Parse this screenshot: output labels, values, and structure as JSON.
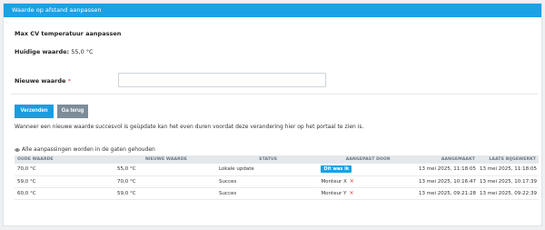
{
  "header": {
    "title": "Waarde op afstand aanpassen"
  },
  "form": {
    "title": "Max CV temperatuur aanpassen",
    "current_label": "Huidige waarde:",
    "current_value": "55,0 °C",
    "new_label": "Nieuwe waarde",
    "required_mark": "*",
    "new_value": "",
    "submit_label": "Verzenden",
    "back_label": "Ga terug",
    "note": "Wanneer een nieuwe waarde succesvol is geüpdate kan het even duren voordat deze verandering hier op het portaal te zien is."
  },
  "history": {
    "note": "Alle aanpassingen worden in de gaten gehouden",
    "columns": [
      "OUDE WAARDE",
      "NIEUWE WAARDE",
      "STATUS",
      "AANGEPAST DOOR",
      "AANGEMAAKT",
      "LAATS BIJGEWERKT"
    ],
    "rows": [
      {
        "old": "70,0 °C",
        "new": "55,0 °C",
        "status": "Lokale update",
        "by": "Dit was ik",
        "by_badge": true,
        "created": "13 mei 2025, 11:18:05",
        "updated": "13 mei 2025, 11:18:05"
      },
      {
        "old": "59,0 °C",
        "new": "70,0 °C",
        "status": "Succes",
        "by": "Monteur X",
        "by_badge": false,
        "created": "13 mei 2025, 10:16:47",
        "updated": "13 mei 2025, 10:17:39"
      },
      {
        "old": "60,0 °C",
        "new": "59,0 °C",
        "status": "Succes",
        "by": "Monteur Y",
        "by_badge": false,
        "created": "13 mei 2025, 09:21:28",
        "updated": "13 mei 2025, 09:22:39"
      }
    ]
  },
  "icons": {
    "history_note": "eye-icon",
    "remove": "close-icon"
  },
  "colors": {
    "accent": "#1aa1e6",
    "secondary_button": "#7c8d99",
    "danger": "#e04848"
  }
}
